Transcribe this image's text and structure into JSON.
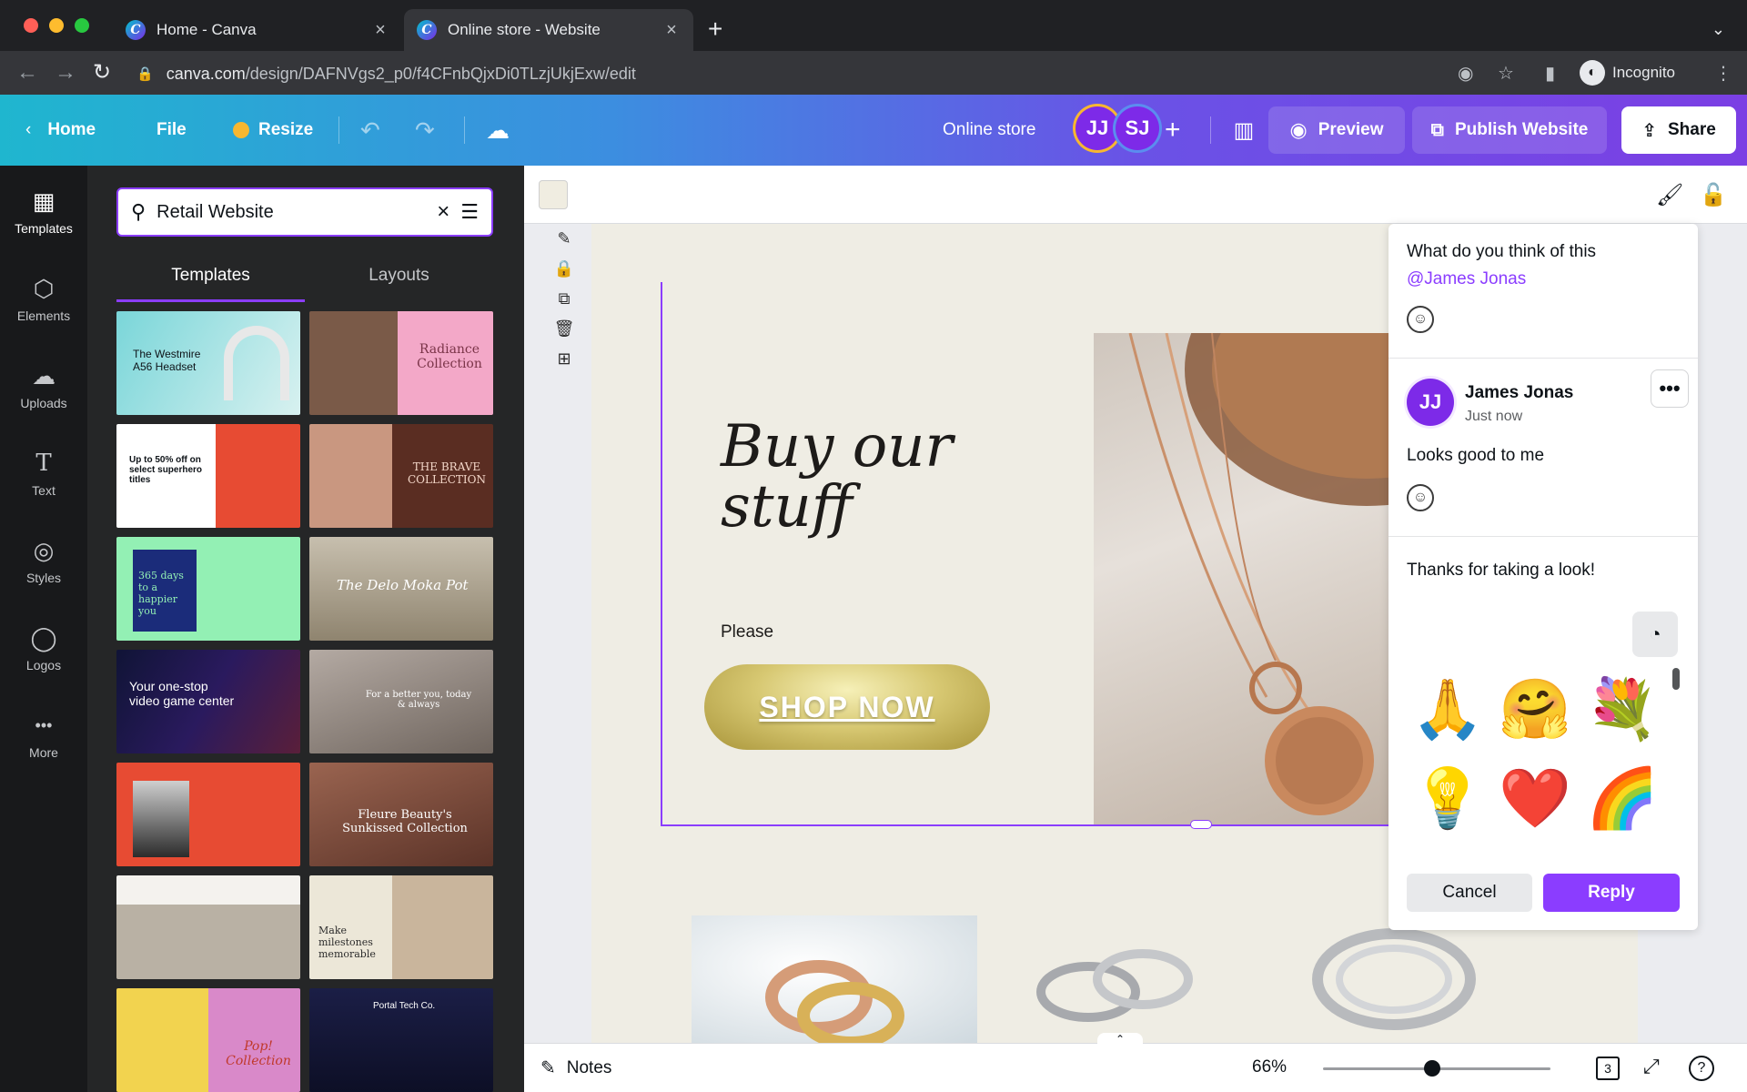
{
  "browser": {
    "tabs": [
      {
        "title": "Home - Canva",
        "active": false
      },
      {
        "title": "Online store - Website",
        "active": true
      }
    ],
    "url_host": "canva.com",
    "url_path": "/design/DAFNVgs2_p0/f4CFnbQjxDi0TLzjUkjExw/edit",
    "incognito_label": "Incognito"
  },
  "topbar": {
    "home": "Home",
    "file": "File",
    "resize": "Resize",
    "design_name": "Online store",
    "collaborators": [
      {
        "initials": "JJ",
        "color": "#7d2ae8",
        "ring": "#f7b731"
      },
      {
        "initials": "SJ",
        "color": "#7d2ae8",
        "ring": "#5b8def"
      }
    ],
    "add_collab": "+",
    "preview": "Preview",
    "publish": "Publish Website",
    "share": "Share"
  },
  "rail": [
    {
      "label": "Templates",
      "icon": "templates-icon",
      "glyph": "▦",
      "active": true
    },
    {
      "label": "Elements",
      "icon": "elements-icon",
      "glyph": "⬡",
      "active": false
    },
    {
      "label": "Uploads",
      "icon": "uploads-icon",
      "glyph": "☁",
      "active": false
    },
    {
      "label": "Text",
      "icon": "text-icon",
      "glyph": "T",
      "active": false
    },
    {
      "label": "Styles",
      "icon": "styles-icon",
      "glyph": "◎",
      "active": false
    },
    {
      "label": "Logos",
      "icon": "logos-icon",
      "glyph": "◯",
      "active": false
    },
    {
      "label": "More",
      "icon": "more-icon",
      "glyph": "•••",
      "active": false
    }
  ],
  "panel": {
    "search_value": "Retail Website",
    "tabs": [
      "Templates",
      "Layouts"
    ],
    "active_tab": "Templates",
    "thumbnails": [
      {
        "text": "The Westmire A56 Headset",
        "bg": "#7ad6d9",
        "fg": "#0e1318"
      },
      {
        "text": "Radiance Collection",
        "bg": "#f3a8c8",
        "fg": "#7a3448"
      },
      {
        "text": "Up to 50% off on select superhero titles",
        "bg": "#ffffff",
        "fg": "#0e1318"
      },
      {
        "text": "THE BRAVE COLLECTION",
        "bg": "#5a2d22",
        "fg": "#f3d6c8"
      },
      {
        "text": "365 days to a happier you",
        "bg": "#93f0b4",
        "fg": "#1b2c7a"
      },
      {
        "text": "The Delo Moka Pot",
        "bg": "#c7bfae",
        "fg": "#ffffff"
      },
      {
        "text": "Your one-stop video game center",
        "bg": "#101436",
        "fg": "#ffffff"
      },
      {
        "text": "For a better you, today & always",
        "bg": "#9c918a",
        "fg": "#ffffff"
      },
      {
        "text": "",
        "bg": "#e74b33",
        "fg": "#ffffff"
      },
      {
        "text": "Fleure Beauty's Sunkissed Collection",
        "bg": "#7a4a3c",
        "fg": "#ffffff"
      },
      {
        "text": "",
        "bg": "#d9d4cb",
        "fg": "#0e1318"
      },
      {
        "text": "Make milestones memorable",
        "bg": "#ece7d8",
        "fg": "#2b2b2b"
      },
      {
        "text": "Pop! Collection",
        "bg": "#d989c9",
        "fg": "#c0392b"
      },
      {
        "text": "Portal Tech Co.",
        "bg": "#1b1e46",
        "fg": "#ffffff"
      }
    ]
  },
  "canvas": {
    "hero_title_line1": "Buy our",
    "hero_title_line2": "stuff",
    "hero_subtitle": "Please",
    "shop_button": "SHOP NOW"
  },
  "comments": {
    "first_comment": "What do you think of this",
    "mention": "@James Jonas",
    "reply_author_initials": "JJ",
    "reply_author": "James Jonas",
    "reply_time": "Just now",
    "reply_text": "Looks good to me",
    "draft_text": "Thanks for taking a look!",
    "stickers": [
      "🙏",
      "🤗",
      "💐",
      "💡",
      "❤️",
      "🌈"
    ],
    "cancel": "Cancel",
    "reply": "Reply"
  },
  "bottom": {
    "notes": "Notes",
    "zoom": "66%",
    "zoom_fraction": 0.48,
    "page_count": "3"
  }
}
